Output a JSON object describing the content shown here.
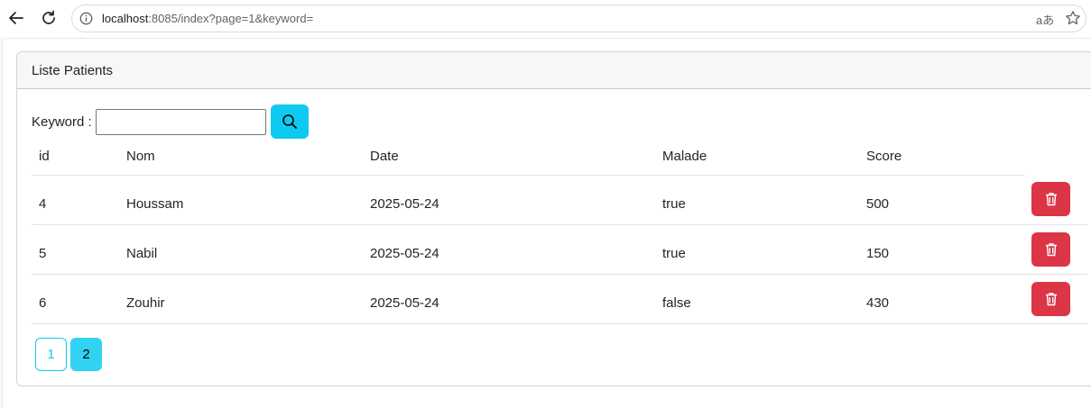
{
  "browser": {
    "url_host": "localhost",
    "url_rest": ":8085/index?page=1&keyword=",
    "translate_label": "aあ"
  },
  "card": {
    "title": "Liste Patients"
  },
  "search": {
    "label": "Keyword :",
    "value": "",
    "placeholder": ""
  },
  "table": {
    "headers": [
      "id",
      "Nom",
      "Date",
      "Malade",
      "Score"
    ],
    "rows": [
      {
        "id": "4",
        "nom": "Houssam",
        "date": "2025-05-24",
        "malade": "true",
        "score": "500"
      },
      {
        "id": "5",
        "nom": "Nabil",
        "date": "2025-05-24",
        "malade": "true",
        "score": "150"
      },
      {
        "id": "6",
        "nom": "Zouhir",
        "date": "2025-05-24",
        "malade": "false",
        "score": "430"
      }
    ]
  },
  "pagination": {
    "pages": [
      "1",
      "2"
    ],
    "current": "2"
  },
  "colors": {
    "info": "#0dcaf0",
    "danger": "#dc3545"
  }
}
